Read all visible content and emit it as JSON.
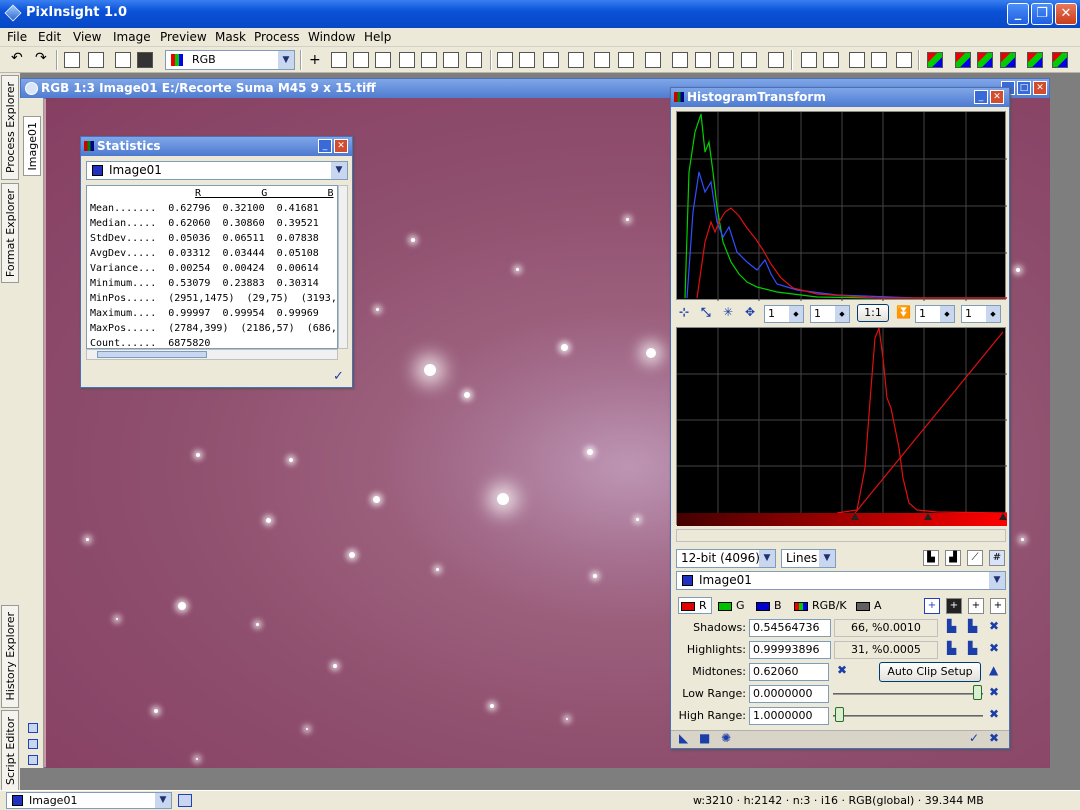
{
  "app": {
    "title": "PixInsight 1.0"
  },
  "menu": [
    "File",
    "Edit",
    "View",
    "Image",
    "Preview",
    "Mask",
    "Process",
    "Window",
    "Help"
  ],
  "toolbar": {
    "color_mode": "RGB"
  },
  "left_tabs": {
    "top": [
      "Process Explorer",
      "Format Explorer"
    ],
    "bottom": [
      "History Explorer",
      "Script Editor"
    ]
  },
  "image_window": {
    "title": "RGB 1:3 Image01 E:/Recorte Suma M45 9 x 15.tiff",
    "tab": "Image01"
  },
  "statistics": {
    "title": "Statistics",
    "view": "Image01",
    "header": "R          G          B",
    "rows": [
      "Mean.......  0.62796  0.32100  0.41681",
      "Median.....  0.62060  0.30860  0.39521",
      "StdDev.....  0.05036  0.06511  0.07838",
      "AvgDev.....  0.03312  0.03444  0.05108",
      "Variance...  0.00254  0.00424  0.00614",
      "Minimum....  0.53079  0.23883  0.30314",
      "MinPos.....  (2951,1475)  (29,75)  (3193,",
      "Maximum....  0.99997  0.99954  0.99969",
      "MaxPos.....  (2784,399)  (2186,57)  (686,",
      "Count......  6875820"
    ]
  },
  "histogram": {
    "title": "HistogramTransform",
    "zoom": [
      "1",
      "1",
      "1",
      "1"
    ],
    "ratio": "1:1",
    "resolution": "12-bit (4096)",
    "style": "Lines",
    "view": "Image01",
    "channels": [
      {
        "label": "R",
        "color": "#e00000"
      },
      {
        "label": "G",
        "color": "#00c000"
      },
      {
        "label": "B",
        "color": "#0000d0"
      },
      {
        "label": "RGB/K",
        "color": "#606060"
      },
      {
        "label": "A",
        "color": "#303030"
      }
    ],
    "shadows": {
      "label": "Shadows:",
      "value": "0.54564736",
      "clip": "66, %0.0010"
    },
    "highlights": {
      "label": "Highlights:",
      "value": "0.99993896",
      "clip": "31, %0.0005"
    },
    "midtones": {
      "label": "Midtones:",
      "value": "0.62060"
    },
    "auto_clip": "Auto Clip Setup",
    "low_range": {
      "label": "Low Range:",
      "value": "0.0000000"
    },
    "high_range": {
      "label": "High Range:",
      "value": "1.0000000"
    }
  },
  "status": {
    "view": "Image01",
    "info": "w:3210 · h:2142 · n:3 · i16 · RGB(global) · 39.344 MB"
  }
}
